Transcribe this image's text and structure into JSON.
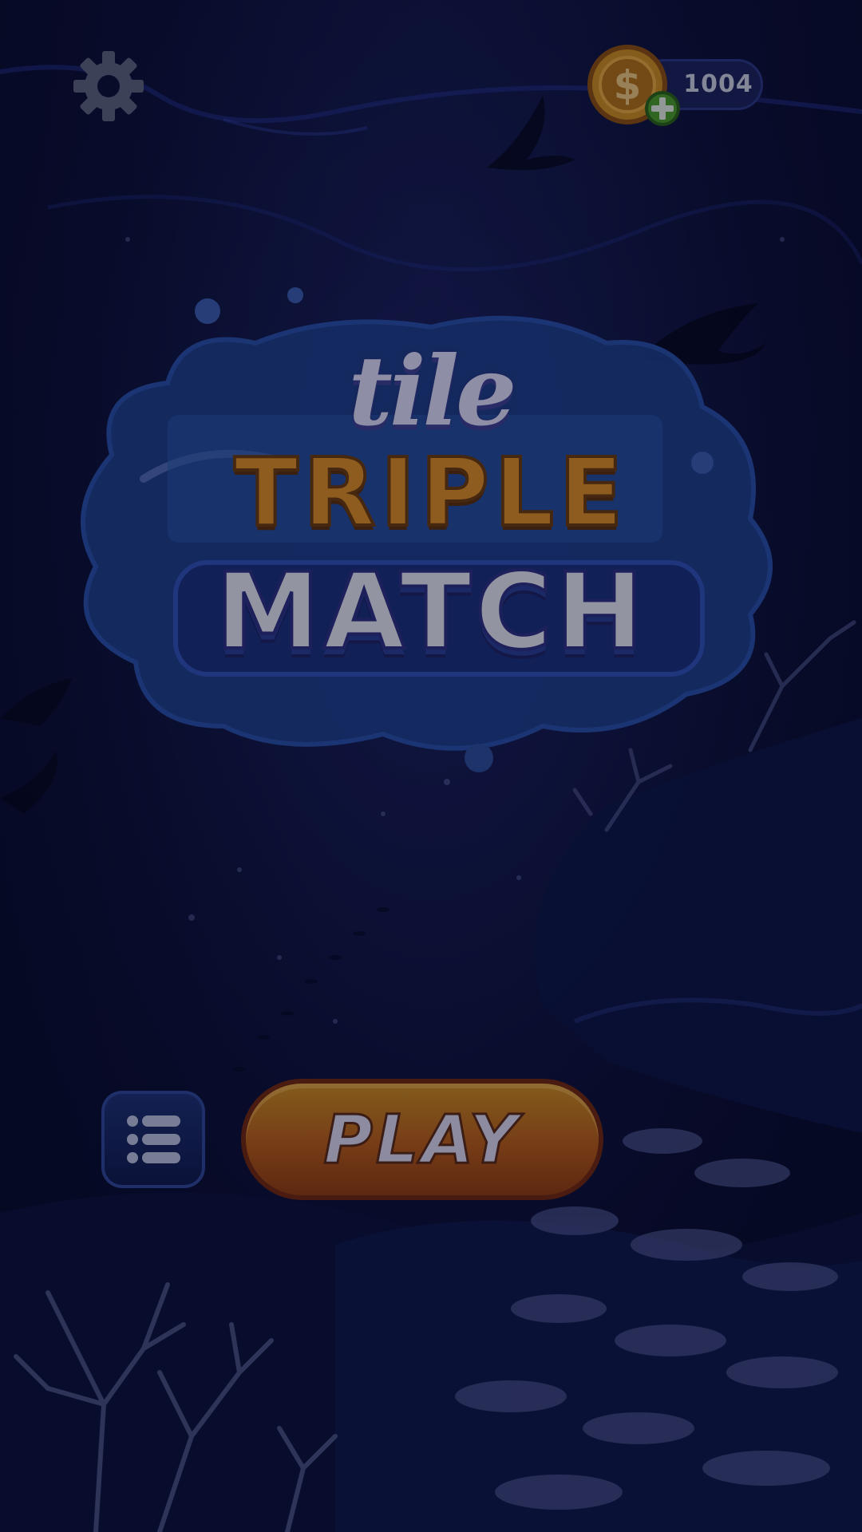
{
  "header": {
    "settings_icon": "gear-icon",
    "coins": {
      "value": "1004",
      "icon": "dollar-coin-icon",
      "add_icon": "plus-icon"
    }
  },
  "logo": {
    "line1": "tile",
    "line2": "TRIPLE",
    "line3": "MATCH"
  },
  "actions": {
    "menu_icon": "list-icon",
    "play_label": "PLAY"
  },
  "colors": {
    "background": "#0c0f32",
    "play_button": "#b45a13",
    "coin": "#c98a1d",
    "plus_badge": "#3f8a1f",
    "menu_button": "#1d2f6e"
  }
}
